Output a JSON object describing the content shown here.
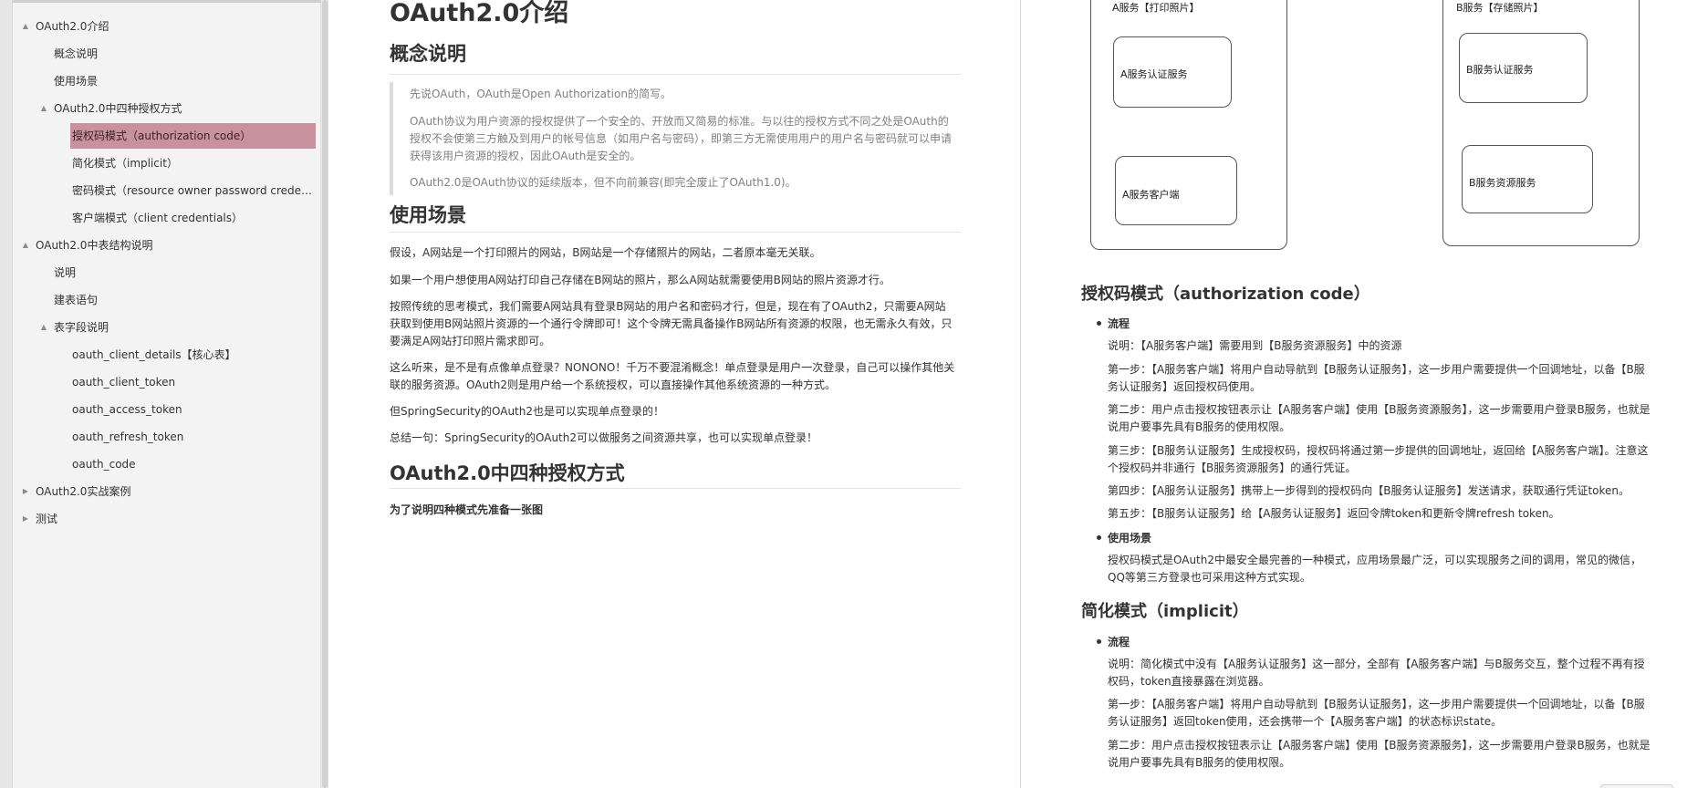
{
  "outline": [
    {
      "level": 1,
      "toggle": "▲",
      "label": "OAuth2.0介绍",
      "name": "outline-item-oauth2-intro"
    },
    {
      "level": 2,
      "toggle": "",
      "label": "概念说明",
      "name": "outline-item-concept"
    },
    {
      "level": 2,
      "toggle": "",
      "label": "使用场景",
      "name": "outline-item-scenarios"
    },
    {
      "level": 2,
      "toggle": "▲",
      "label": "OAuth2.0中四种授权方式",
      "name": "outline-item-four-grants"
    },
    {
      "level": 3,
      "toggle": "",
      "label": "授权码模式（authorization code）",
      "name": "outline-item-authorization-code",
      "active": true
    },
    {
      "level": 3,
      "toggle": "",
      "label": "简化模式（implicit）",
      "name": "outline-item-implicit"
    },
    {
      "level": 3,
      "toggle": "",
      "label": "密码模式（resource owner password credentials）",
      "name": "outline-item-password"
    },
    {
      "level": 3,
      "toggle": "",
      "label": "客户端模式（client credentials）",
      "name": "outline-item-client-credentials"
    },
    {
      "level": 1,
      "toggle": "▲",
      "label": "OAuth2.0中表结构说明",
      "name": "outline-item-table-structure"
    },
    {
      "level": 2,
      "toggle": "",
      "label": "说明",
      "name": "outline-item-explanation"
    },
    {
      "level": 2,
      "toggle": "",
      "label": "建表语句",
      "name": "outline-item-create-table"
    },
    {
      "level": 2,
      "toggle": "▲",
      "label": "表字段说明",
      "name": "outline-item-table-fields"
    },
    {
      "level": 3,
      "toggle": "",
      "label": "oauth_client_details【核心表】",
      "name": "outline-item-oauth-client-details"
    },
    {
      "level": 3,
      "toggle": "",
      "label": "oauth_client_token",
      "name": "outline-item-oauth-client-token"
    },
    {
      "level": 3,
      "toggle": "",
      "label": "oauth_access_token",
      "name": "outline-item-oauth-access-token"
    },
    {
      "level": 3,
      "toggle": "",
      "label": "oauth_refresh_token",
      "name": "outline-item-oauth-refresh-token"
    },
    {
      "level": 3,
      "toggle": "",
      "label": "oauth_code",
      "name": "outline-item-oauth-code"
    },
    {
      "level": 1,
      "toggle": "▶",
      "label": "OAuth2.0实战案例",
      "name": "outline-item-practice"
    },
    {
      "level": 1,
      "toggle": "▶",
      "label": "测试",
      "name": "outline-item-test"
    }
  ],
  "doc": {
    "title": "OAuth2.0介绍",
    "concept_heading": "概念说明",
    "quote": [
      "先说OAuth，OAuth是Open Authorization的简写。",
      "OAuth协议为用户资源的授权提供了一个安全的、开放而又简易的标准。与以往的授权方式不同之处是OAuth的授权不会使第三方触及到用户的帐号信息（如用户名与密码），即第三方无需使用用户的用户名与密码就可以申请获得该用户资源的授权，因此OAuth是安全的。",
      "OAuth2.0是OAuth协议的延续版本，但不向前兼容(即完全废止了OAuth1.0)。"
    ],
    "scenario_heading": "使用场景",
    "scenario_paras": [
      "假设，A网站是一个打印照片的网站，B网站是一个存储照片的网站，二者原本毫无关联。",
      "如果一个用户想使用A网站打印自己存储在B网站的照片，那么A网站就需要使用B网站的照片资源才行。",
      "按照传统的思考模式，我们需要A网站具有登录B网站的用户名和密码才行，但是，现在有了OAuth2，只需要A网站获取到使用B网站照片资源的一个通行令牌即可！这个令牌无需具备操作B网站所有资源的权限，也无需永久有效，只要满足A网站打印照片需求即可。",
      "这么听来，是不是有点像单点登录？NONONO！千万不要混淆概念！单点登录是用户一次登录，自己可以操作其他关联的服务资源。OAuth2则是用户给一个系统授权，可以直接操作其他系统资源的一种方式。",
      "但SpringSecurity的OAuth2也是可以实现单点登录的！",
      "总结一句：SpringSecurity的OAuth2可以做服务之间资源共享，也可以实现单点登录！"
    ],
    "grants_heading": "OAuth2.0中四种授权方式",
    "grants_note": "为了说明四种模式先准备一张图"
  },
  "figure": {
    "a_caption": "A服务【打印照片】",
    "b_caption": "B服务【存储照片】",
    "a_auth": "A服务认证服务",
    "a_client": "A服务客户端",
    "b_auth": "B服务认证服务",
    "b_resource": "B服务资源服务"
  },
  "right": {
    "authcode_heading": "授权码模式（authorization code）",
    "flow_label": "流程",
    "authcode_paras": [
      "说明：【A服务客户端】需要用到【B服务资源服务】中的资源",
      "第一步：【A服务客户端】将用户自动导航到【B服务认证服务】，这一步用户需要提供一个回调地址，以备【B服务认证服务】返回授权码使用。",
      "第二步：用户点击授权按钮表示让【A服务客户端】使用【B服务资源服务】，这一步需要用户登录B服务，也就是说用户要事先具有B服务的使用权限。",
      "第三步：【B服务认证服务】生成授权码，授权码将通过第一步提供的回调地址，返回给【A服务客户端】。注意这个授权码并非通行【B服务资源服务】的通行凭证。",
      "第四步：【A服务认证服务】携带上一步得到的授权码向【B服务认证服务】发送请求，获取通行凭证token。",
      "第五步：【B服务认证服务】给【A服务认证服务】返回令牌token和更新令牌refresh token。"
    ],
    "scenario_label": "使用场景",
    "authcode_scenario": "授权码模式是OAuth2中最安全最完善的一种模式，应用场景最广泛，可以实现服务之间的调用，常见的微信，QQ等第三方登录也可采用这种方式实现。",
    "implicit_heading": "简化模式（implicit）",
    "implicit_flow_label": "流程",
    "implicit_paras": [
      "说明：简化模式中没有【A服务认证服务】这一部分，全部有【A服务客户端】与B服务交互，整个过程不再有授权码，token直接暴露在浏览器。",
      "第一步：【A服务客户端】将用户自动导航到【B服务认证服务】，这一步用户需要提供一个回调地址，以备【B服务认证服务】返回token使用，还会携带一个【A服务客户端】的状态标识state。",
      "第二步：用户点击授权按钮表示让【A服务客户端】使用【B服务资源服务】，这一步需要用户登录B服务，也就是说用户要事先具有B服务的使用权限。"
    ]
  },
  "colors": {
    "active_highlight": "#c9919d",
    "sidebar_bg": "#f3f3f3",
    "quote_text": "#808080"
  }
}
